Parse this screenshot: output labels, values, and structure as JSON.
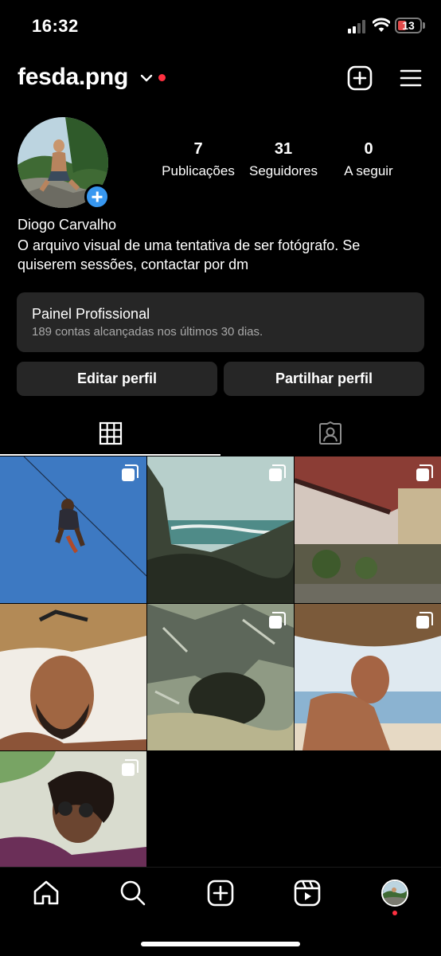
{
  "status_bar": {
    "time": "16:32",
    "battery": "13"
  },
  "header": {
    "username": "fesda.png",
    "notification_dot_color": "#ff3040"
  },
  "profile": {
    "stats": [
      {
        "value": "7",
        "label": "Publicações"
      },
      {
        "value": "31",
        "label": "Seguidores"
      },
      {
        "value": "0",
        "label": "A seguir"
      }
    ],
    "name": "Diogo Carvalho",
    "bio": "O arquivo visual de uma tentativa de ser fotógrafo. Se quiserem sessões, contactar por dm"
  },
  "dashboard": {
    "title": "Painel Profissional",
    "subtitle": "189 contas alcançadas nos últimos 30 dias."
  },
  "actions": {
    "edit_label": "Editar perfil",
    "share_label": "Partilhar perfil"
  },
  "tabs": [
    {
      "icon": "grid-icon",
      "active": true
    },
    {
      "icon": "tagged-icon",
      "active": false
    }
  ],
  "posts": [
    {
      "description_icon": "multi-image-icon",
      "multi": true
    },
    {
      "description_icon": "multi-image-icon",
      "multi": true
    },
    {
      "description_icon": "multi-image-icon",
      "multi": true
    },
    {
      "multi": false
    },
    {
      "description_icon": "multi-image-icon",
      "multi": true
    },
    {
      "description_icon": "multi-image-icon",
      "multi": true
    },
    {
      "description_icon": "multi-image-icon",
      "multi": true
    }
  ],
  "bottom_nav": [
    {
      "icon": "home-icon"
    },
    {
      "icon": "search-icon"
    },
    {
      "icon": "create-icon"
    },
    {
      "icon": "reels-icon"
    },
    {
      "icon": "profile-avatar"
    }
  ],
  "colors": {
    "accent": "#3797f0",
    "surface": "#262626",
    "muted_text": "#a8a8a8"
  }
}
